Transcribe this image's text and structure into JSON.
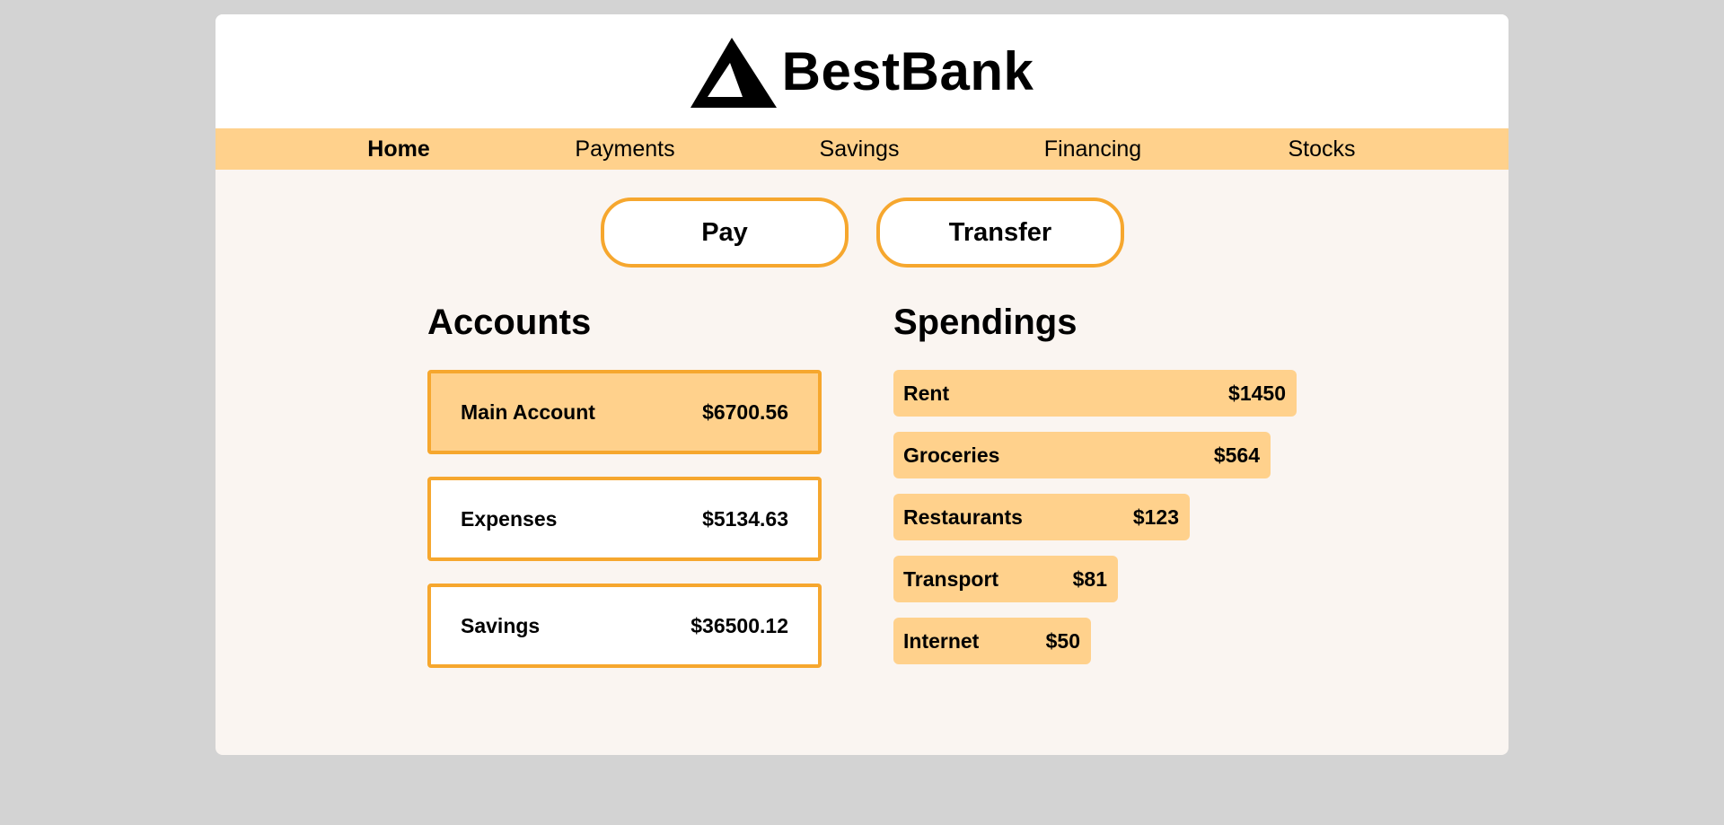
{
  "brand": {
    "name": "BestBank",
    "logo_icon": "triangle-logo-icon"
  },
  "nav": {
    "items": [
      {
        "label": "Home",
        "active": true
      },
      {
        "label": "Payments",
        "active": false
      },
      {
        "label": "Savings",
        "active": false
      },
      {
        "label": "Financing",
        "active": false
      },
      {
        "label": "Stocks",
        "active": false
      }
    ]
  },
  "actions": {
    "pay_label": "Pay",
    "transfer_label": "Transfer"
  },
  "accounts": {
    "title": "Accounts",
    "items": [
      {
        "name": "Main Account",
        "balance": "$6700.56",
        "selected": true
      },
      {
        "name": "Expenses",
        "balance": "$5134.63",
        "selected": false
      },
      {
        "name": "Savings",
        "balance": "$36500.12",
        "selected": false
      }
    ]
  },
  "spendings": {
    "title": "Spendings",
    "items": [
      {
        "category": "Rent",
        "amount": "$1450"
      },
      {
        "category": "Groceries",
        "amount": "$564"
      },
      {
        "category": "Restaurants",
        "amount": "$123"
      },
      {
        "category": "Transport",
        "amount": "$81"
      },
      {
        "category": "Internet",
        "amount": "$50"
      }
    ]
  },
  "colors": {
    "page_background": "#d3d3d3",
    "content_background": "#faf5f1",
    "accent": "#ffd18c",
    "border_accent": "#f6a72e"
  }
}
